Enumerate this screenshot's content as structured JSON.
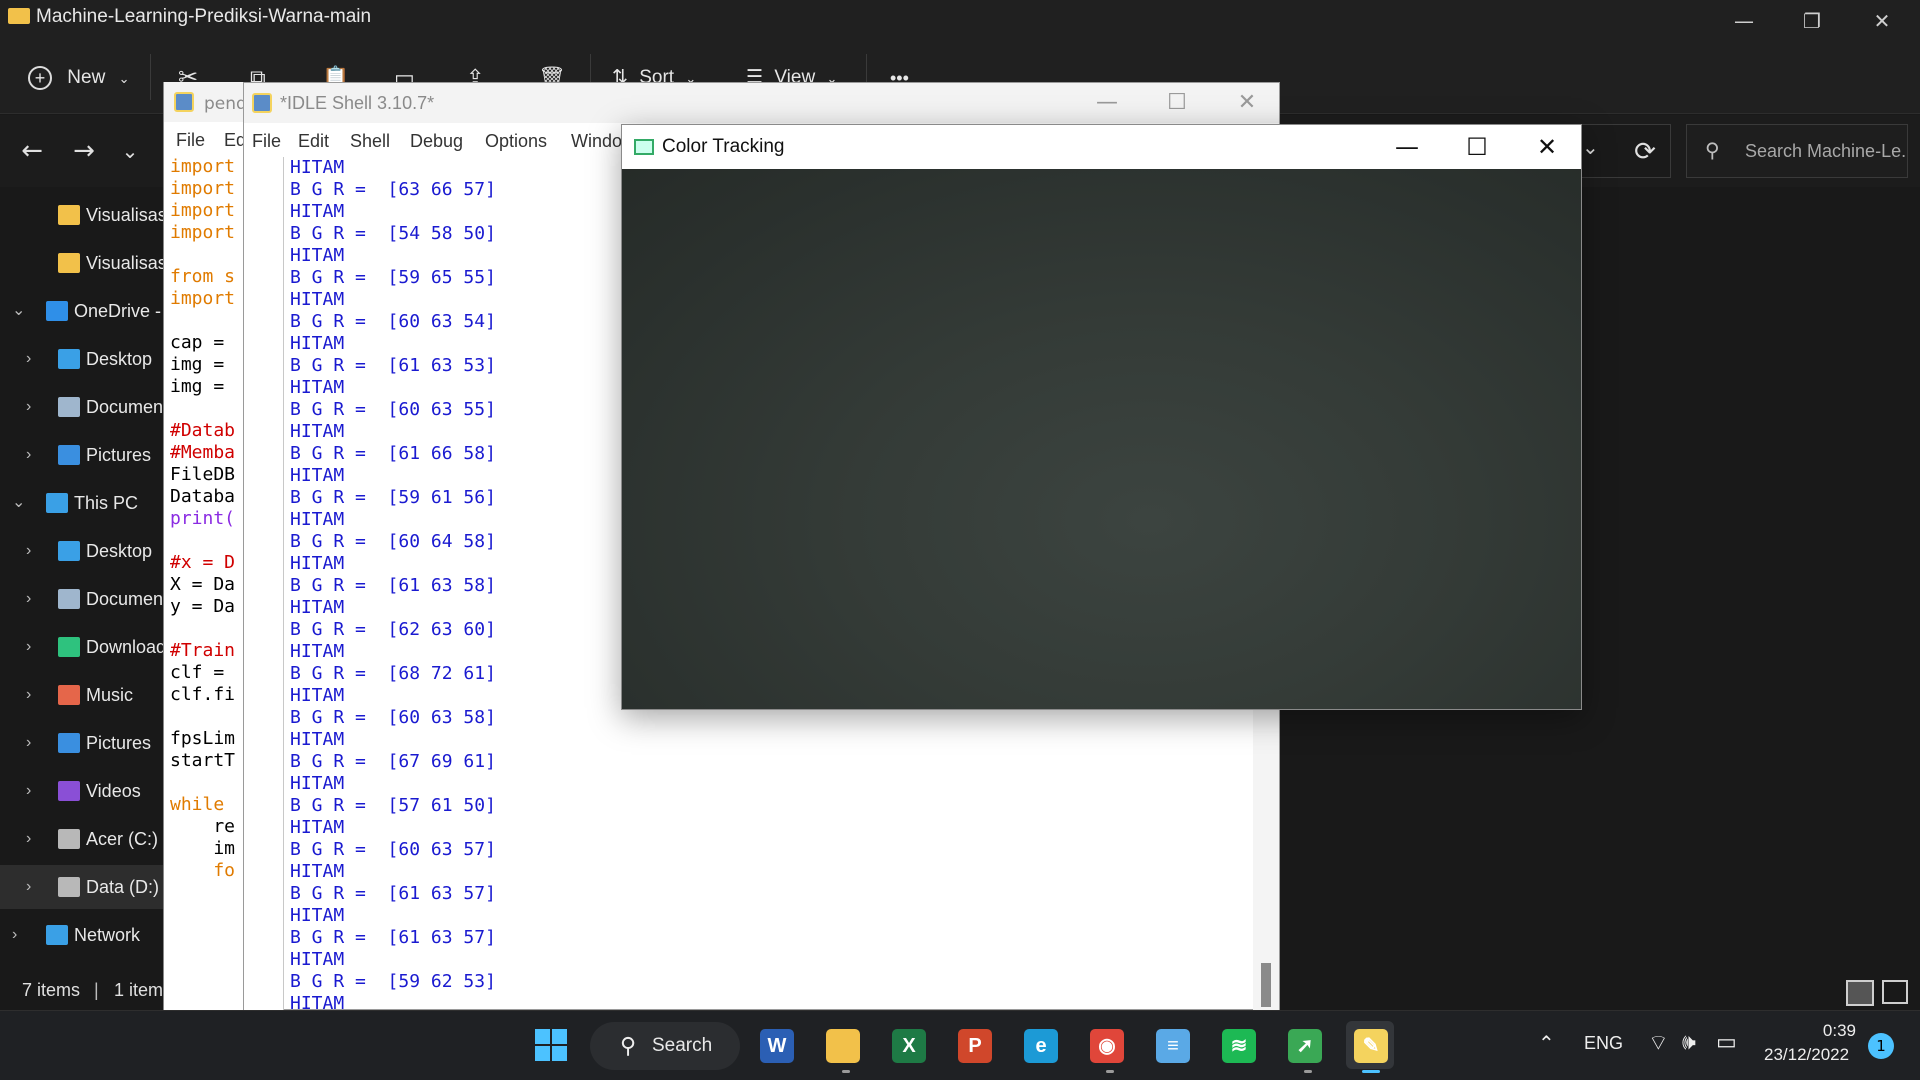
{
  "explorer": {
    "title": "Machine-Learning-Prediksi-Warna-main",
    "toolbar": {
      "new_label": "New",
      "sort_label": "Sort",
      "view_label": "View",
      "more_label": "•••"
    },
    "search_placeholder": "Search Machine-Le...",
    "sidebar": [
      {
        "label": "Visualisasi",
        "icon": "folder-icon",
        "color": "#f2c14a"
      },
      {
        "label": "Visualisasi",
        "icon": "folder-icon",
        "color": "#f2c14a"
      },
      {
        "label": "OneDrive -",
        "icon": "cloud-icon",
        "color": "#2f8fe8"
      },
      {
        "label": "Desktop",
        "icon": "desktop-icon",
        "color": "#3aa0e6"
      },
      {
        "label": "Documents",
        "icon": "documents-icon",
        "color": "#9fb6cd"
      },
      {
        "label": "Pictures",
        "icon": "pictures-icon",
        "color": "#3a8fe0"
      },
      {
        "label": "This PC",
        "icon": "computer-icon",
        "color": "#3aa0e6"
      },
      {
        "label": "Desktop",
        "icon": "desktop-icon",
        "color": "#3aa0e6"
      },
      {
        "label": "Documents",
        "icon": "documents-icon",
        "color": "#9fb6cd"
      },
      {
        "label": "Downloads",
        "icon": "downloads-icon",
        "color": "#2ec27e"
      },
      {
        "label": "Music",
        "icon": "music-icon",
        "color": "#e5664a"
      },
      {
        "label": "Pictures",
        "icon": "pictures-icon",
        "color": "#3a8fe0"
      },
      {
        "label": "Videos",
        "icon": "videos-icon",
        "color": "#8a4fd6"
      },
      {
        "label": "Acer (C:)",
        "icon": "drive-icon",
        "color": "#b8b8b8"
      },
      {
        "label": "Data (D:)",
        "icon": "drive-icon",
        "color": "#b8b8b8"
      },
      {
        "label": "Network",
        "icon": "network-icon",
        "color": "#3aa0e6"
      }
    ],
    "status": {
      "items": "7 items",
      "selected": "1 item"
    }
  },
  "editor": {
    "title": "pend",
    "menu": [
      "File",
      "Ed"
    ],
    "lines": [
      {
        "t": "import",
        "c": "#e07b00"
      },
      {
        "t": "import",
        "c": "#e07b00"
      },
      {
        "t": "import",
        "c": "#e07b00"
      },
      {
        "t": "import",
        "c": "#e07b00"
      },
      {
        "t": "",
        "c": "#000"
      },
      {
        "t": "from s",
        "c": "#e07b00"
      },
      {
        "t": "import",
        "c": "#e07b00"
      },
      {
        "t": "",
        "c": "#000"
      },
      {
        "t": "cap =",
        "c": "#000"
      },
      {
        "t": "img =",
        "c": "#000"
      },
      {
        "t": "img =",
        "c": "#000"
      },
      {
        "t": "",
        "c": "#000"
      },
      {
        "t": "#Datab",
        "c": "#d00000"
      },
      {
        "t": "#Memba",
        "c": "#d00000"
      },
      {
        "t": "FileDB",
        "c": "#000"
      },
      {
        "t": "Databa",
        "c": "#000"
      },
      {
        "t": "print(",
        "c": "#8a2be2"
      },
      {
        "t": "",
        "c": "#000"
      },
      {
        "t": "#x = D",
        "c": "#d00000"
      },
      {
        "t": "X = Da",
        "c": "#000"
      },
      {
        "t": "y = Da",
        "c": "#000"
      },
      {
        "t": "",
        "c": "#000"
      },
      {
        "t": "#Train",
        "c": "#d00000"
      },
      {
        "t": "clf =",
        "c": "#000"
      },
      {
        "t": "clf.fi",
        "c": "#000"
      },
      {
        "t": "",
        "c": "#000"
      },
      {
        "t": "fpsLim",
        "c": "#000"
      },
      {
        "t": "startT",
        "c": "#000"
      },
      {
        "t": "",
        "c": "#000"
      },
      {
        "t": "while",
        "c": "#e07b00"
      },
      {
        "t": "    re",
        "c": "#000"
      },
      {
        "t": "    im",
        "c": "#000"
      },
      {
        "t": "    fo",
        "c": "#e07b00"
      }
    ]
  },
  "shell": {
    "title": "*IDLE Shell 3.10.7*",
    "menu": [
      "File",
      "Edit",
      "Shell",
      "Debug",
      "Options",
      "Windo"
    ],
    "label_text": "HITAM",
    "bgr_prefix": "B G R =",
    "values": [
      "[63 66 57]",
      "[54 58 50]",
      "[59 65 55]",
      "[60 63 54]",
      "[61 63 53]",
      "[60 63 55]",
      "[61 66 58]",
      "[59 61 56]",
      "[60 64 58]",
      "[61 63 58]",
      "[62 63 60]",
      "[68 72 61]",
      "[60 63 58]",
      "[67 69 61]",
      "[57 61 50]",
      "[60 63 57]",
      "[61 63 57]",
      "[61 63 57]",
      "[59 62 53]"
    ]
  },
  "color_tracking": {
    "title": "Color Tracking"
  },
  "taskbar": {
    "search_label": "Search",
    "apps": [
      {
        "name": "word-app-icon",
        "color": "#2b5fb4",
        "glyph": "W"
      },
      {
        "name": "file-explorer-app-icon",
        "color": "#f2c14a",
        "glyph": ""
      },
      {
        "name": "excel-app-icon",
        "color": "#1e7a45",
        "glyph": "X"
      },
      {
        "name": "powerpoint-app-icon",
        "color": "#d0472b",
        "glyph": "P"
      },
      {
        "name": "edge-app-icon",
        "color": "#1c9ad6",
        "glyph": "e"
      },
      {
        "name": "chrome-app-icon",
        "color": "#e0463a",
        "glyph": "◉"
      },
      {
        "name": "notepad-app-icon",
        "color": "#5aa9e6",
        "glyph": "≡"
      },
      {
        "name": "spotify-app-icon",
        "color": "#1db954",
        "glyph": "≋"
      },
      {
        "name": "internet-download-manager-app-icon",
        "color": "#3aa855",
        "glyph": "➚"
      },
      {
        "name": "python-idle-app-icon",
        "color": "#f4d35e",
        "glyph": "✎"
      }
    ],
    "tray": {
      "language": "ENG",
      "time": "0:39",
      "date": "23/12/2022",
      "notification_count": "1"
    }
  }
}
